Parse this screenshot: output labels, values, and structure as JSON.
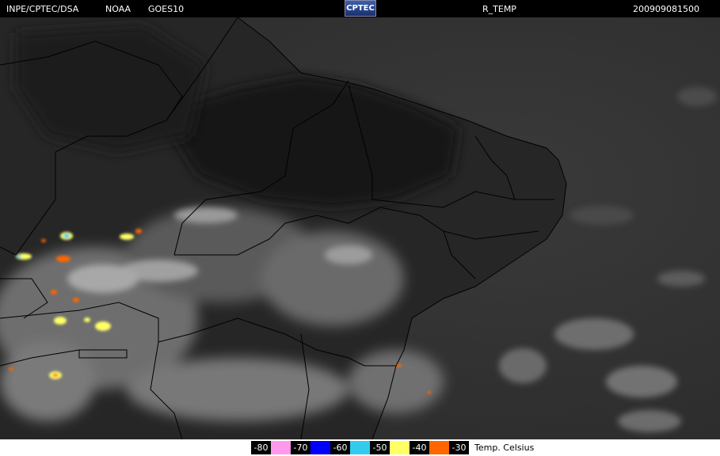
{
  "header": {
    "source": "INPE/CPTEC/DSA",
    "agency": "NOAA",
    "satellite": "GOES10",
    "logo_text": "CPTEC",
    "product": "R_TEMP",
    "timestamp": "200909081500"
  },
  "legend": {
    "items": [
      {
        "label": "-80",
        "color": "#ff99ee"
      },
      {
        "label": "-70",
        "color": "#0000ff"
      },
      {
        "label": "-60",
        "color": "#33ccee"
      },
      {
        "label": "-50",
        "color": "#ffff66"
      },
      {
        "label": "-40",
        "color": "#ff6600"
      },
      {
        "label": "-30",
        "color": "#ffffff"
      }
    ],
    "unit": "Temp. Celsius"
  },
  "colors": {
    "land_dark": "#1c1c1c",
    "ocean": "#333333",
    "cloud_low": "#8a8a8a",
    "cloud_high": "#c8c8c8",
    "border": "#000000"
  }
}
